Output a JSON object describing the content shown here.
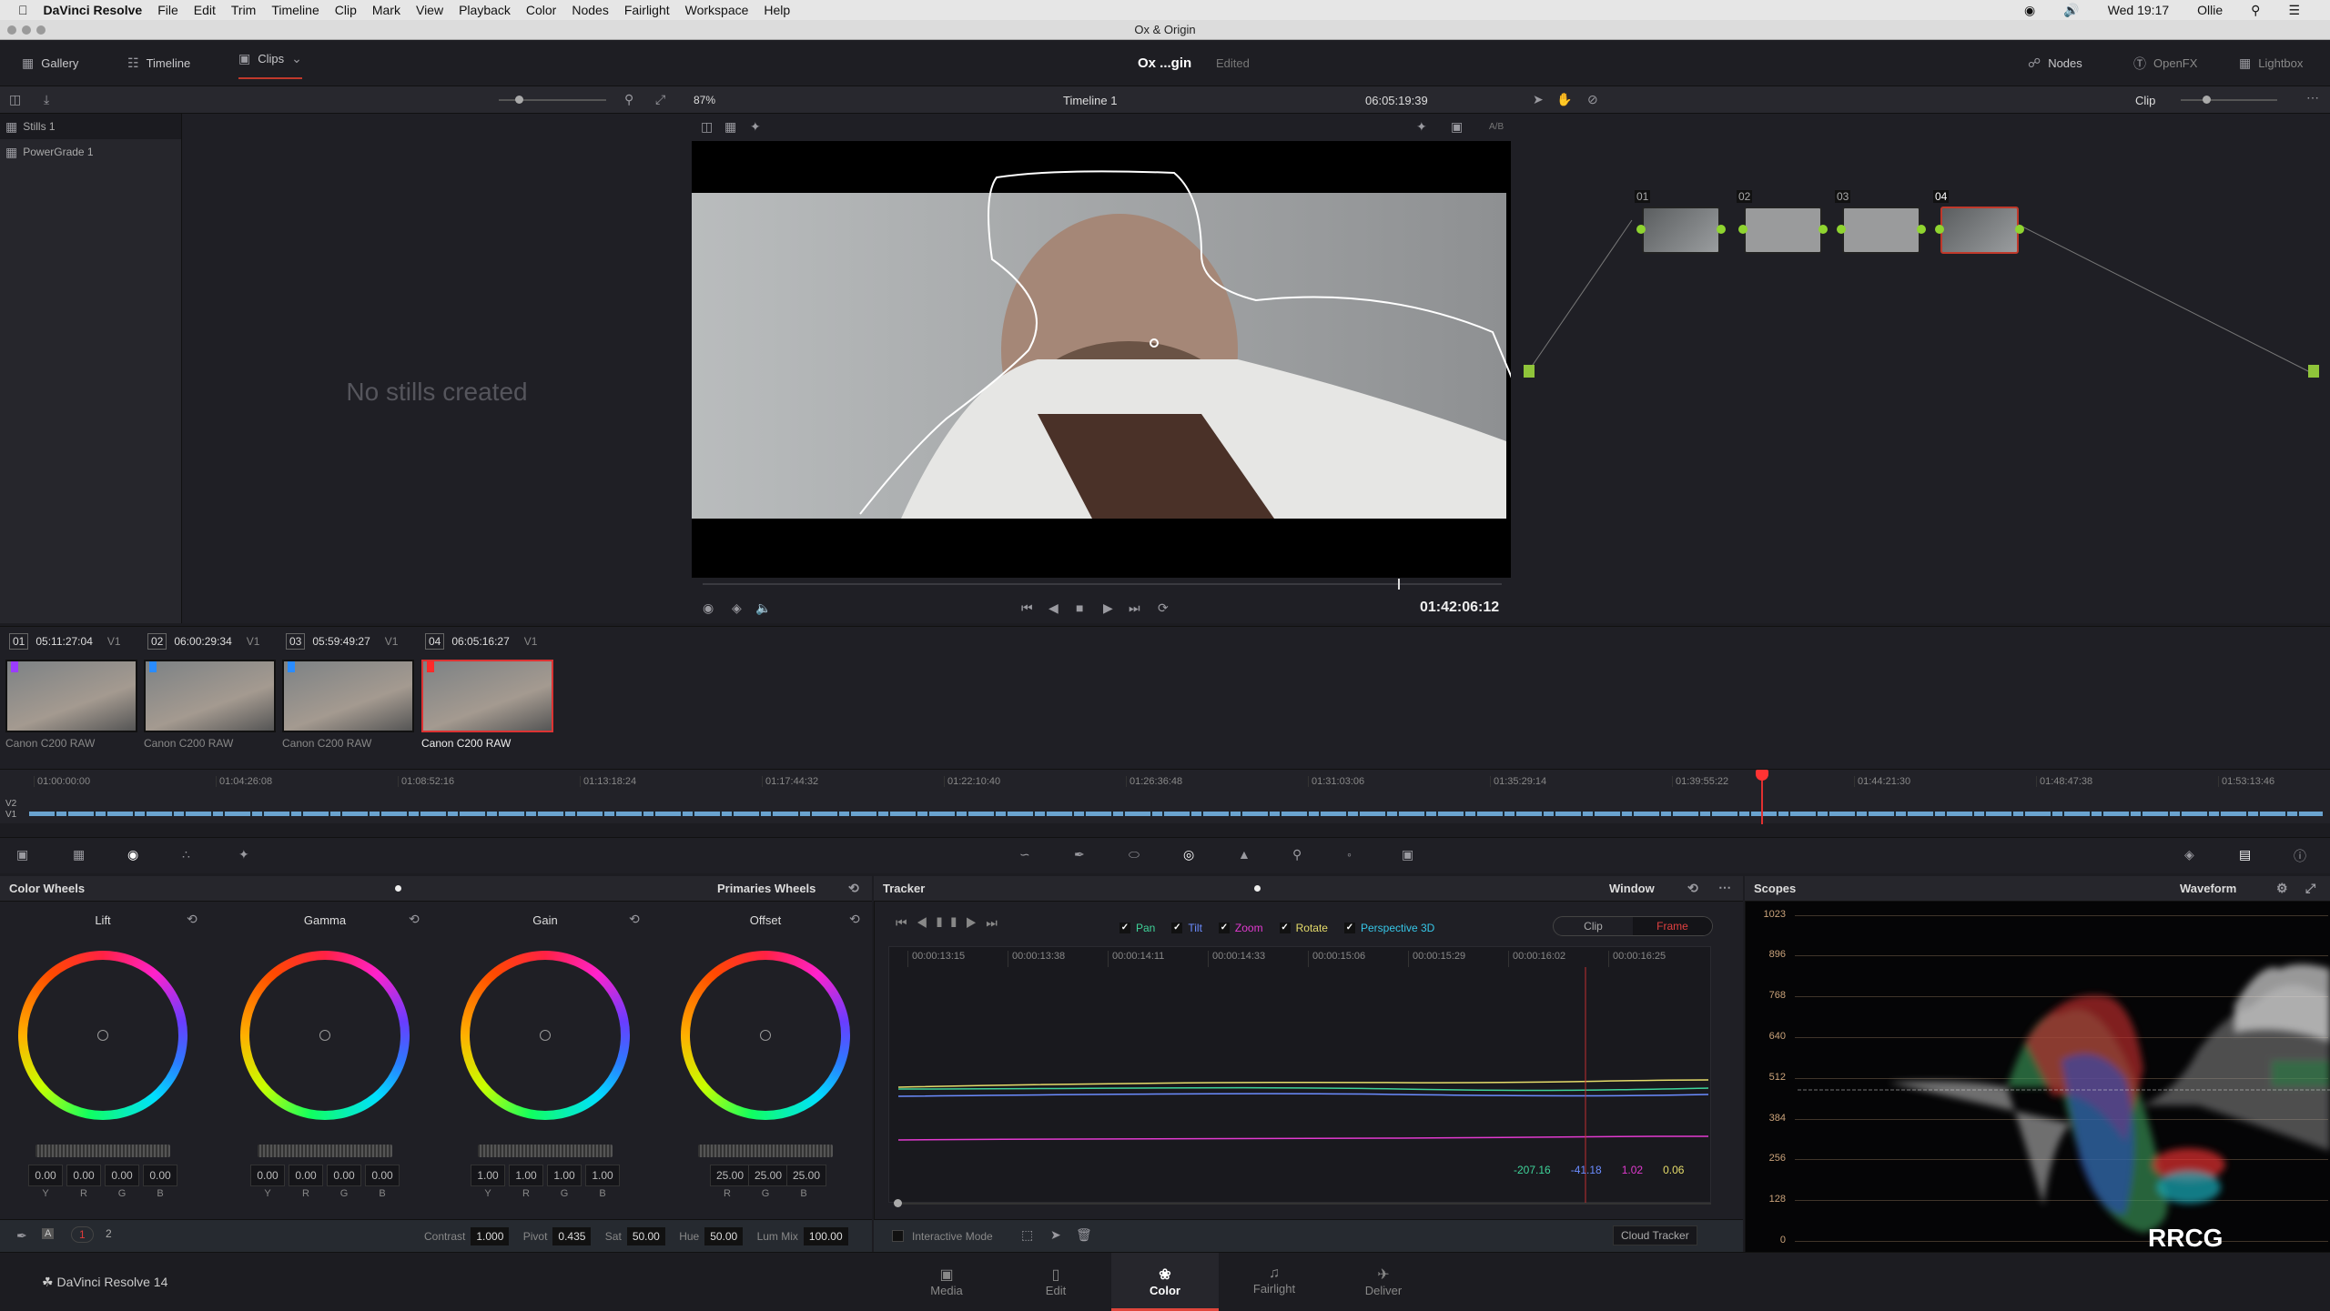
{
  "menubar": {
    "app": "DaVinci Resolve",
    "items": [
      "File",
      "Edit",
      "Trim",
      "Timeline",
      "Clip",
      "Mark",
      "View",
      "Playback",
      "Color",
      "Nodes",
      "Fairlight",
      "Workspace",
      "Help"
    ],
    "clock": "Wed 19:17",
    "user": "Ollie"
  },
  "window_title": "Ox & Origin",
  "header": {
    "gallery": "Gallery",
    "timeline": "Timeline",
    "clips": "Clips",
    "project": "Ox ...gin",
    "status": "Edited",
    "nodes": "Nodes",
    "openfx": "OpenFX",
    "lightbox": "Lightbox"
  },
  "toolbar": {
    "zoom": "87%",
    "timeline_name": "Timeline 1",
    "timecode": "06:05:19:39",
    "node_mode": "Clip"
  },
  "gallery": {
    "albums": [
      "Stills 1",
      "PowerGrade 1"
    ],
    "empty_text": "No stills created"
  },
  "viewer": {
    "timecode": "01:42:06:12",
    "scrub_fraction": 0.87,
    "ab_label": "A/B"
  },
  "nodes": [
    {
      "label": "01"
    },
    {
      "label": "02"
    },
    {
      "label": "03"
    },
    {
      "label": "04"
    }
  ],
  "clips": [
    {
      "num": "01",
      "tc": "05:11:27:04",
      "track": "V1",
      "name": "Canon C200 RAW",
      "flag": "#9b3cff"
    },
    {
      "num": "02",
      "tc": "06:00:29:34",
      "track": "V1",
      "name": "Canon C200 RAW",
      "flag": "#2a8cff"
    },
    {
      "num": "03",
      "tc": "05:59:49:27",
      "track": "V1",
      "name": "Canon C200 RAW",
      "flag": "#2a8cff"
    },
    {
      "num": "04",
      "tc": "06:05:16:27",
      "track": "V1",
      "name": "Canon C200 RAW",
      "flag": "#ff2a2a",
      "selected": true
    }
  ],
  "timeline": {
    "tracks": [
      "V2",
      "V1"
    ],
    "ticks": [
      "01:00:00:00",
      "01:04:26:08",
      "01:08:52:16",
      "01:13:18:24",
      "01:17:44:32",
      "01:22:10:40",
      "01:26:36:48",
      "01:31:03:06",
      "01:35:29:14",
      "01:39:55:22",
      "01:44:21:30",
      "01:48:47:38",
      "01:53:13:46"
    ],
    "playhead": "01:42:06:12"
  },
  "color_wheels": {
    "title": "Color Wheels",
    "mode": "Primaries Wheels",
    "wheels": [
      {
        "name": "Lift",
        "values": [
          "0.00",
          "0.00",
          "0.00",
          "0.00"
        ],
        "channels": [
          "Y",
          "R",
          "G",
          "B"
        ]
      },
      {
        "name": "Gamma",
        "values": [
          "0.00",
          "0.00",
          "0.00",
          "0.00"
        ],
        "channels": [
          "Y",
          "R",
          "G",
          "B"
        ]
      },
      {
        "name": "Gain",
        "values": [
          "1.00",
          "1.00",
          "1.00",
          "1.00"
        ],
        "channels": [
          "Y",
          "R",
          "G",
          "B"
        ]
      },
      {
        "name": "Offset",
        "values": [
          "25.00",
          "25.00",
          "25.00"
        ],
        "channels": [
          "R",
          "G",
          "B"
        ]
      }
    ],
    "bottom": {
      "auto": "A",
      "page1": "1",
      "page2": "2",
      "contrast_label": "Contrast",
      "contrast": "1.000",
      "pivot_label": "Pivot",
      "pivot": "0.435",
      "sat_label": "Sat",
      "sat": "50.00",
      "hue_label": "Hue",
      "hue": "50.00",
      "lummix_label": "Lum Mix",
      "lummix": "100.00"
    }
  },
  "tracker": {
    "title": "Tracker",
    "mode": "Window",
    "options": [
      {
        "label": "Pan",
        "color": "#3fd49a"
      },
      {
        "label": "Tilt",
        "color": "#6b8cff"
      },
      {
        "label": "Zoom",
        "color": "#e23ad0"
      },
      {
        "label": "Rotate",
        "color": "#e6dc6a"
      },
      {
        "label": "Perspective 3D",
        "color": "#36c7e8"
      }
    ],
    "clip": "Clip",
    "frame": "Frame",
    "ticks": [
      "00:00:13:15",
      "00:00:13:38",
      "00:00:14:11",
      "00:00:14:33",
      "00:00:15:06",
      "00:00:15:29",
      "00:00:16:02",
      "00:00:16:25"
    ],
    "readouts": [
      {
        "value": "-207.16",
        "color": "#3fd49a"
      },
      {
        "value": "-41.18",
        "color": "#6b8cff"
      },
      {
        "value": "1.02",
        "color": "#e23ad0"
      },
      {
        "value": "0.06",
        "color": "#e6dc6a"
      }
    ],
    "interactive_mode": "Interactive Mode",
    "cloud_tracker": "Cloud Tracker"
  },
  "scopes": {
    "title": "Scopes",
    "mode": "Waveform",
    "levels": [
      "1023",
      "896",
      "768",
      "640",
      "512",
      "384",
      "256",
      "128",
      "0"
    ]
  },
  "footer": {
    "app": "DaVinci Resolve 14",
    "pages": [
      "Media",
      "Edit",
      "Color",
      "Fairlight",
      "Deliver"
    ],
    "active": "Color"
  },
  "accent": "#e0463c"
}
